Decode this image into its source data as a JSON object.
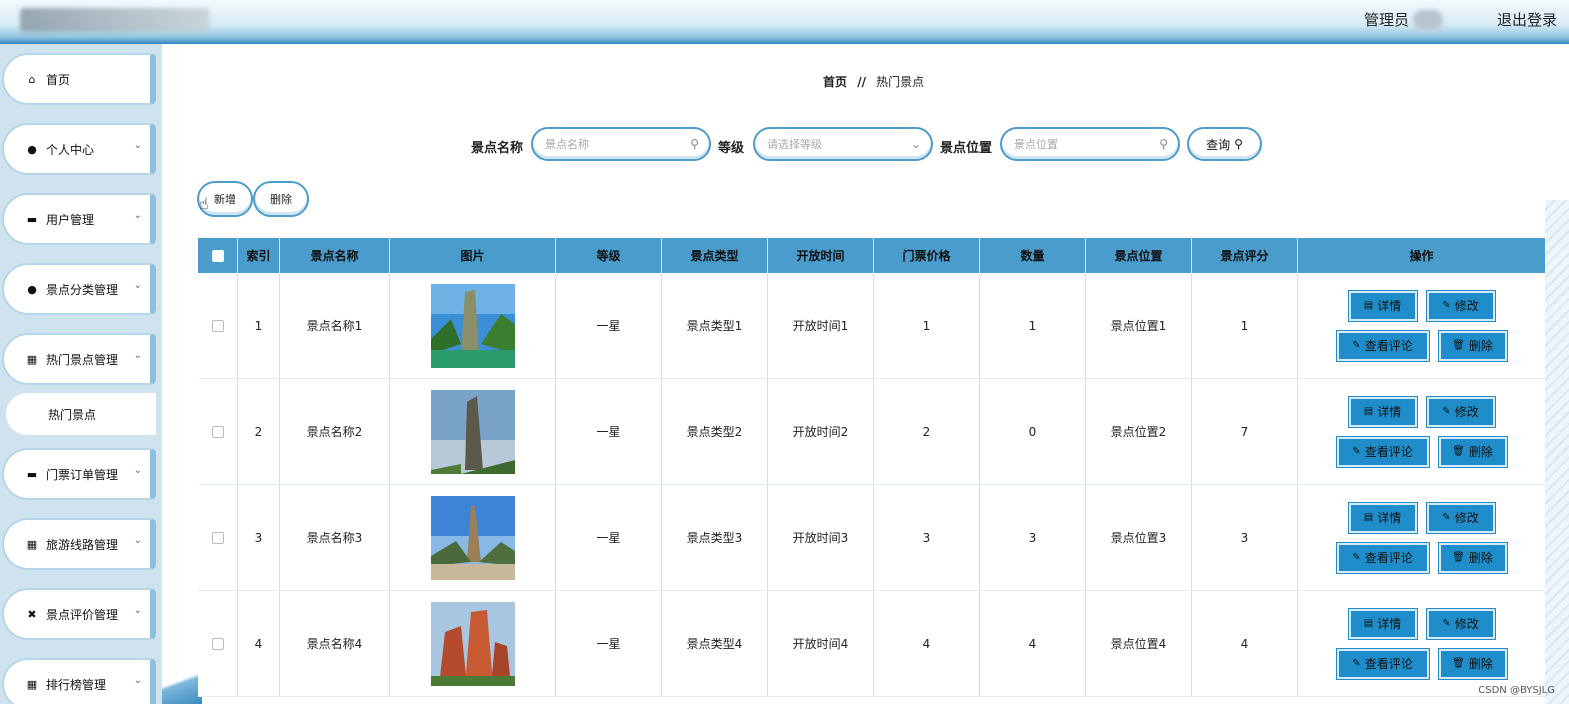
{
  "header": {
    "admin_label": "管理员",
    "logout_label": "退出登录"
  },
  "sidebar": {
    "items": [
      {
        "label": "首页",
        "icon": "home-icon",
        "glyph": "⌂",
        "has_chevron": false
      },
      {
        "label": "个人中心",
        "icon": "user-icon",
        "glyph": "●",
        "has_chevron": true
      },
      {
        "label": "用户管理",
        "icon": "message-icon",
        "glyph": "▬",
        "has_chevron": true
      },
      {
        "label": "景点分类管理",
        "icon": "user-icon",
        "glyph": "●",
        "has_chevron": true
      },
      {
        "label": "热门景点管理",
        "icon": "grid-icon",
        "glyph": "▦",
        "has_chevron": true
      },
      {
        "label": "门票订单管理",
        "icon": "ticket-icon",
        "glyph": "▬",
        "has_chevron": true
      },
      {
        "label": "旅游线路管理",
        "icon": "grid-icon",
        "glyph": "▦",
        "has_chevron": true
      },
      {
        "label": "景点评价管理",
        "icon": "rating-icon",
        "glyph": "✖",
        "has_chevron": true
      },
      {
        "label": "排行榜管理",
        "icon": "grid-icon",
        "glyph": "▦",
        "has_chevron": true
      }
    ],
    "subitem": "热门景点"
  },
  "breadcrumb": {
    "home": "首页",
    "separator": "//",
    "current": "热门景点"
  },
  "search": {
    "name_label": "景点名称",
    "name_placeholder": "景点名称",
    "level_label": "等级",
    "level_placeholder": "请选择等级",
    "location_label": "景点位置",
    "location_placeholder": "景点位置",
    "query_label": "查询"
  },
  "actions": {
    "add_label": "新增",
    "delete_label": "删除"
  },
  "table": {
    "headers": [
      "索引",
      "景点名称",
      "图片",
      "等级",
      "景点类型",
      "开放时间",
      "门票价格",
      "数量",
      "景点位置",
      "景点评分",
      "操作"
    ],
    "rows": [
      {
        "index": "1",
        "name": "景点名称1",
        "level": "一星",
        "type": "景点类型1",
        "open_time": "开放时间1",
        "price": "1",
        "count": "1",
        "location": "景点位置1",
        "score": "1"
      },
      {
        "index": "2",
        "name": "景点名称2",
        "level": "一星",
        "type": "景点类型2",
        "open_time": "开放时间2",
        "price": "2",
        "count": "0",
        "location": "景点位置2",
        "score": "7"
      },
      {
        "index": "3",
        "name": "景点名称3",
        "level": "一星",
        "type": "景点类型3",
        "open_time": "开放时间3",
        "price": "3",
        "count": "3",
        "location": "景点位置3",
        "score": "3"
      },
      {
        "index": "4",
        "name": "景点名称4",
        "level": "一星",
        "type": "景点类型4",
        "open_time": "开放时间4",
        "price": "4",
        "count": "4",
        "location": "景点位置4",
        "score": "4"
      }
    ],
    "row_actions": {
      "detail": "详情",
      "edit": "修改",
      "view_comments": "查看评论",
      "delete": "删除"
    }
  },
  "watermark": "CSDN @BYSJLG",
  "colors": {
    "accent": "#4a9ccd",
    "button": "#1f8dc9",
    "sidebar_bg": "#cfe3ee"
  }
}
